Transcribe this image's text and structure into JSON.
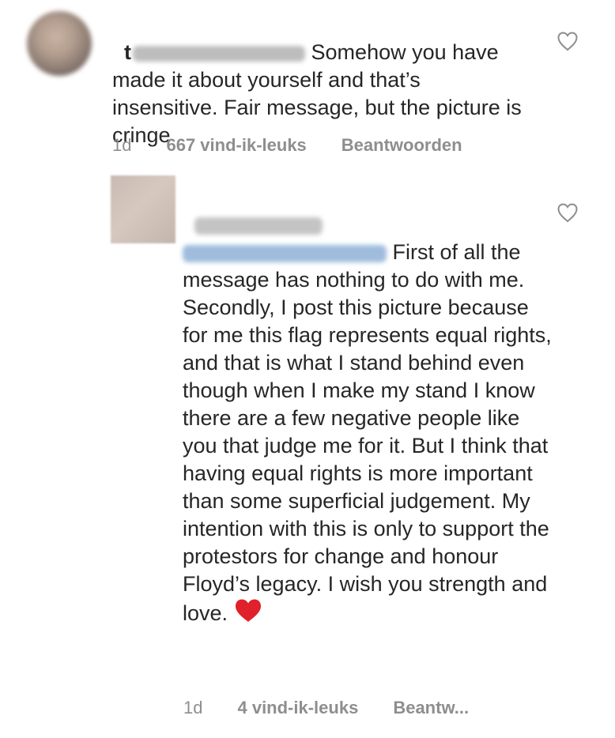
{
  "comments": [
    {
      "username_redacted": true,
      "username_visible_prefix": "t",
      "text": "Somehow you have made it about yourself and that’s insensitive. Fair message, but the picture is cringe",
      "time": "1d",
      "likes": "667 vind-ik-leuks",
      "reply_label": "Beantwoorden",
      "like_icon": "heart-outline-icon"
    },
    {
      "username_redacted": true,
      "mention_redacted": true,
      "text": "First of all the message has nothing to do with me. Secondly, I post this picture because for me this flag represents equal rights, and that is what I stand behind even though when I make my stand I know there are a few negative people like you that judge me for it. But I think that having equal rights is more important than some superficial judgement. My intention with this is only to support the protestors for change and honour Floyd’s legacy. I wish you strength and love.",
      "emoji": "red-heart-icon",
      "time": "1d",
      "likes": "4 vind-ik-leuks",
      "reply_label": "Beantw...",
      "like_icon": "heart-outline-icon"
    }
  ],
  "colors": {
    "text": "#262626",
    "meta": "#8e8e8e",
    "heart_red": "#e0202a",
    "mention_blue": "#9fbcdc"
  }
}
